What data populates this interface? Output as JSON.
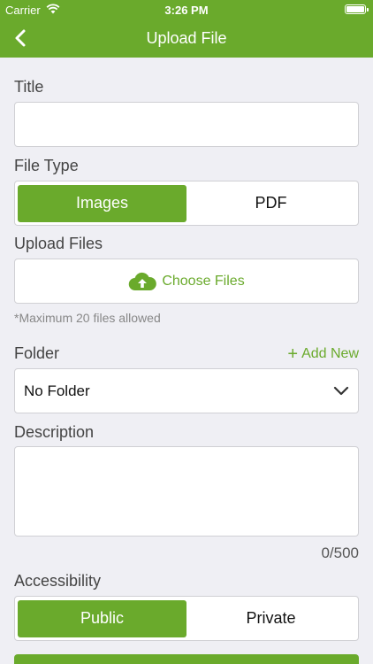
{
  "status_bar": {
    "carrier": "Carrier",
    "time": "3:26 PM"
  },
  "nav": {
    "title": "Upload File"
  },
  "form": {
    "title_label": "Title",
    "title_value": "",
    "file_type_label": "File Type",
    "file_type_options": [
      "Images",
      "PDF"
    ],
    "file_type_selected": "Images",
    "upload_label": "Upload Files",
    "choose_files": "Choose Files",
    "max_hint": "*Maximum 20 files allowed",
    "folder_label": "Folder",
    "add_new": "Add New",
    "folder_value": "No Folder",
    "description_label": "Description",
    "description_value": "",
    "char_counter": "0/500",
    "accessibility_label": "Accessibility",
    "accessibility_options": [
      "Public",
      "Private"
    ],
    "accessibility_selected": "Public"
  },
  "colors": {
    "accent": "#6aaa2c",
    "background": "#efeff4"
  }
}
